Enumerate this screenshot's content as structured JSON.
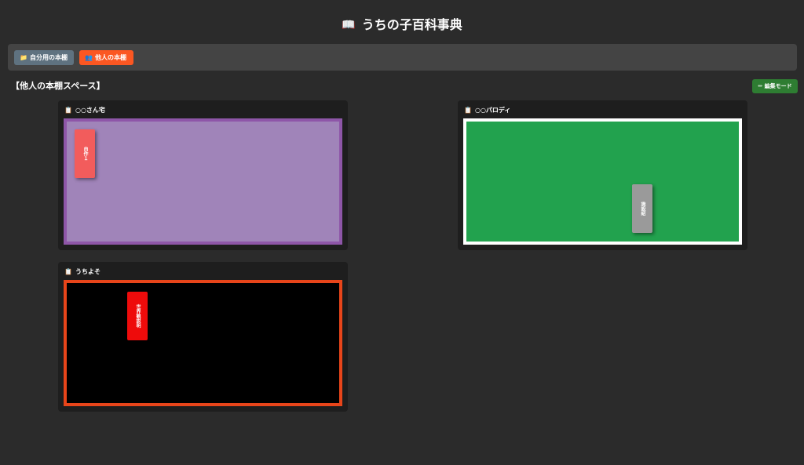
{
  "app": {
    "title": "うちの子百科事典",
    "title_icon": "📖"
  },
  "tabs": [
    {
      "label": "自分用の本棚",
      "icon": "📁",
      "color": "#5f7280"
    },
    {
      "label": "他人の本棚",
      "icon": "👥",
      "color": "#fb5722",
      "active": true
    }
  ],
  "section": {
    "title": "【他人の本棚スペース】"
  },
  "toolbar": {
    "edit_label": "✏ 編集モード",
    "edit_color": "#2e7d32"
  },
  "shelves": [
    {
      "name": "○○さん宅",
      "icon": "📋",
      "background": "#a084b9",
      "border": "#8e56a8",
      "books": [
        {
          "title": "自作１",
          "color": "#f25c5c"
        }
      ]
    },
    {
      "name": "○○パロディ",
      "icon": "📋",
      "background": "#22a24e",
      "border": "#ffffff",
      "books": [
        {
          "title": "施設紹",
          "color": "#9a9a9a"
        }
      ]
    },
    {
      "name": "うちよそ",
      "icon": "📋",
      "background": "#000000",
      "border": "#e8451a",
      "books": [
        {
          "title": "世界観説明",
          "color": "#ee0b0b"
        }
      ]
    }
  ]
}
